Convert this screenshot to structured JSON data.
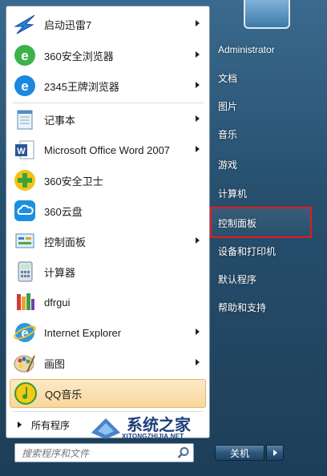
{
  "programs": [
    {
      "label": "启动迅雷7",
      "icon": "thunder-icon",
      "arrow": true
    },
    {
      "label": "360安全浏览器",
      "icon": "360-browser-icon",
      "arrow": true
    },
    {
      "label": "2345王牌浏览器",
      "icon": "2345-browser-icon",
      "arrow": true
    },
    {
      "label": "记事本",
      "icon": "notepad-icon",
      "arrow": true
    },
    {
      "label": "Microsoft Office Word 2007",
      "icon": "word-icon",
      "arrow": true
    },
    {
      "label": "360安全卫士",
      "icon": "360-safe-icon",
      "arrow": false
    },
    {
      "label": "360云盘",
      "icon": "360-cloud-icon",
      "arrow": false
    },
    {
      "label": "控制面板",
      "icon": "control-panel-icon",
      "arrow": true
    },
    {
      "label": "计算器",
      "icon": "calculator-icon",
      "arrow": false
    },
    {
      "label": "dfrgui",
      "icon": "defrag-icon",
      "arrow": false
    },
    {
      "label": "Internet Explorer",
      "icon": "ie-icon",
      "arrow": true
    },
    {
      "label": "画图",
      "icon": "paint-icon",
      "arrow": true
    },
    {
      "label": "QQ音乐",
      "icon": "qq-music-icon",
      "arrow": false,
      "highlighted": true
    }
  ],
  "all_programs": "所有程序",
  "search": {
    "placeholder": "搜索程序和文件"
  },
  "right_menu": [
    "Administrator",
    "文档",
    "图片",
    "音乐",
    "游戏",
    "计算机",
    "控制面板",
    "设备和打印机",
    "默认程序",
    "帮助和支持"
  ],
  "highlighted_right_item": "控制面板",
  "shutdown_label": "关机",
  "watermark": {
    "title": "系统之家",
    "url": "XITONGZHIJIA.NET"
  },
  "colors": {
    "highlight_box": "#e21c1c",
    "selection": "#f8d89b",
    "frame": "#27506f"
  }
}
